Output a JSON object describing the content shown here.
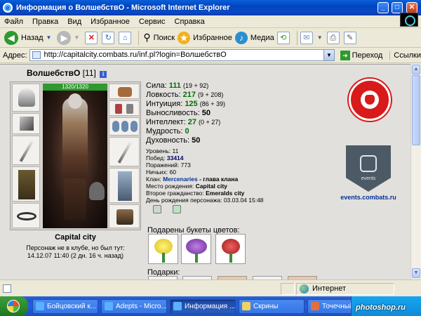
{
  "window": {
    "title": "Информация о ВолшебствО - Microsoft Internet Explorer",
    "minimize": "_",
    "maximize": "□",
    "close": "✕"
  },
  "menu": [
    "Файл",
    "Правка",
    "Вид",
    "Избранное",
    "Сервис",
    "Справка"
  ],
  "toolbar": {
    "back": "Назад",
    "search": "Поиск",
    "favorites": "Избранное",
    "media": "Медиа"
  },
  "address": {
    "label": "Адрес:",
    "url": "http://capitalcity.combats.ru/inf.pl?login=ВолшебствО",
    "go": "Переход",
    "links": "Ссылки"
  },
  "character": {
    "name": "ВолшебствО",
    "level_badge": "[11]",
    "hp": "1320/1320",
    "city": "Capital city",
    "club_status": "Персонаж не в клубе, но был тут:",
    "last_seen": "14.12.07 11:40 (2 дн. 16 ч. назад)"
  },
  "stats": [
    {
      "label": "Сила:",
      "value": "111",
      "extra": "(19 + 92)",
      "green": true
    },
    {
      "label": "Ловкость:",
      "value": "217",
      "extra": "(9 + 208)",
      "green": true
    },
    {
      "label": "Интуиция:",
      "value": "125",
      "extra": "(86 + 39)",
      "green": true
    },
    {
      "label": "Выносливость:",
      "value": "50",
      "extra": "",
      "green": false
    },
    {
      "label": "Интеллект:",
      "value": "27",
      "extra": "(0 + 27)",
      "green": true
    },
    {
      "label": "Мудрость:",
      "value": "0",
      "extra": "",
      "green": true
    },
    {
      "label": "Духовность:",
      "value": "50",
      "extra": "",
      "green": false
    }
  ],
  "info": {
    "level_label": "Уровень:",
    "level": "11",
    "wins_label": "Побед:",
    "wins": "33414",
    "losses_label": "Поражений:",
    "losses": "773",
    "draws_label": "Ничьих:",
    "draws": "60",
    "clan_label": "Клан:",
    "clan": "Mercenaries",
    "clan_role": " - глава клана",
    "birthplace_label": "Место рождения:",
    "birthplace": "Capital city",
    "second_citizenship_label": "Второе гражданство:",
    "second_citizenship": "Emeralds city",
    "birthday_label": "День рождения персонажа:",
    "birthday": "03.03.04 15:48"
  },
  "emblems": {
    "events_link": "events.combats.ru",
    "fist_caption": "events"
  },
  "flowers_title": "Подарены букеты цветов:",
  "gifts_title": "Подарки:",
  "status": {
    "zone": "Интернет"
  },
  "taskbar": {
    "tasks": [
      "Бойцовский к...",
      "Adepts - Micro...",
      "Информация ...",
      "Скрины",
      "Точечный рис..."
    ]
  },
  "watermark": "photoshop.ru",
  "colors": {
    "title_blue": "#0045c0",
    "stat_green": "#007000",
    "clan_link": "#003399",
    "lion_red": "#d81a1a"
  }
}
